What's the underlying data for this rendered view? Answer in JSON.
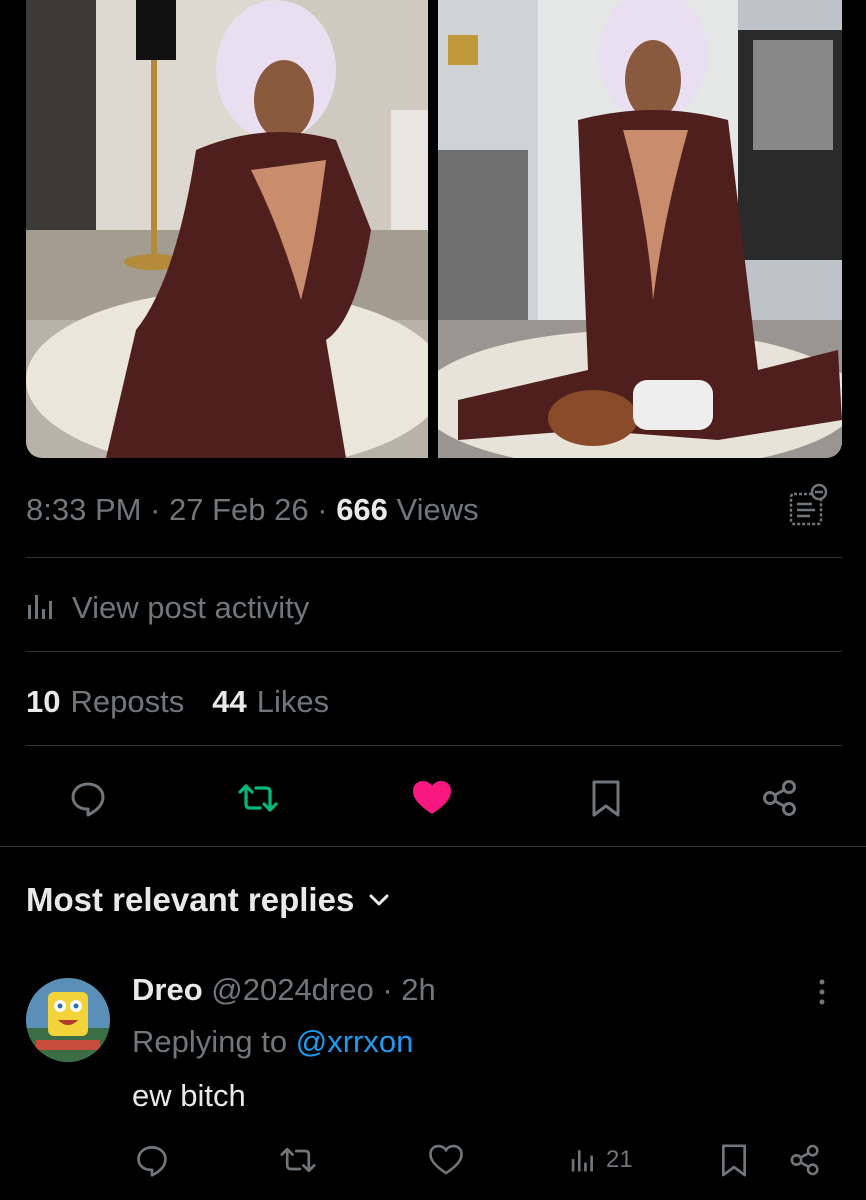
{
  "media": {
    "left_alt": "sim-character-photo-1",
    "right_alt": "sim-character-photo-2"
  },
  "post_meta": {
    "time": "8:33 PM",
    "sep1": " · ",
    "date": "27 Feb 26",
    "sep2": " · ",
    "views_count": "666",
    "views_label": " Views"
  },
  "activity": {
    "label": "View post activity"
  },
  "stats": {
    "reposts_count": "10",
    "reposts_label": "Reposts",
    "likes_count": "44",
    "likes_label": "Likes"
  },
  "colors": {
    "accent_blue": "#1d9bf0",
    "repost_green": "#00ba7c",
    "like_pink": "#f91880",
    "muted": "#71767b"
  },
  "actions": {
    "icons": [
      "reply-icon",
      "repost-icon",
      "like-icon",
      "bookmark-icon",
      "share-icon"
    ]
  },
  "replies": {
    "header": "Most relevant replies"
  },
  "reply": {
    "name": "Dreo",
    "handle": " @2024dreo · 2h",
    "replying_prefix": "Replying to ",
    "replying_mention": "@xrrxon",
    "text": "ew bitch",
    "views_count": "21"
  }
}
